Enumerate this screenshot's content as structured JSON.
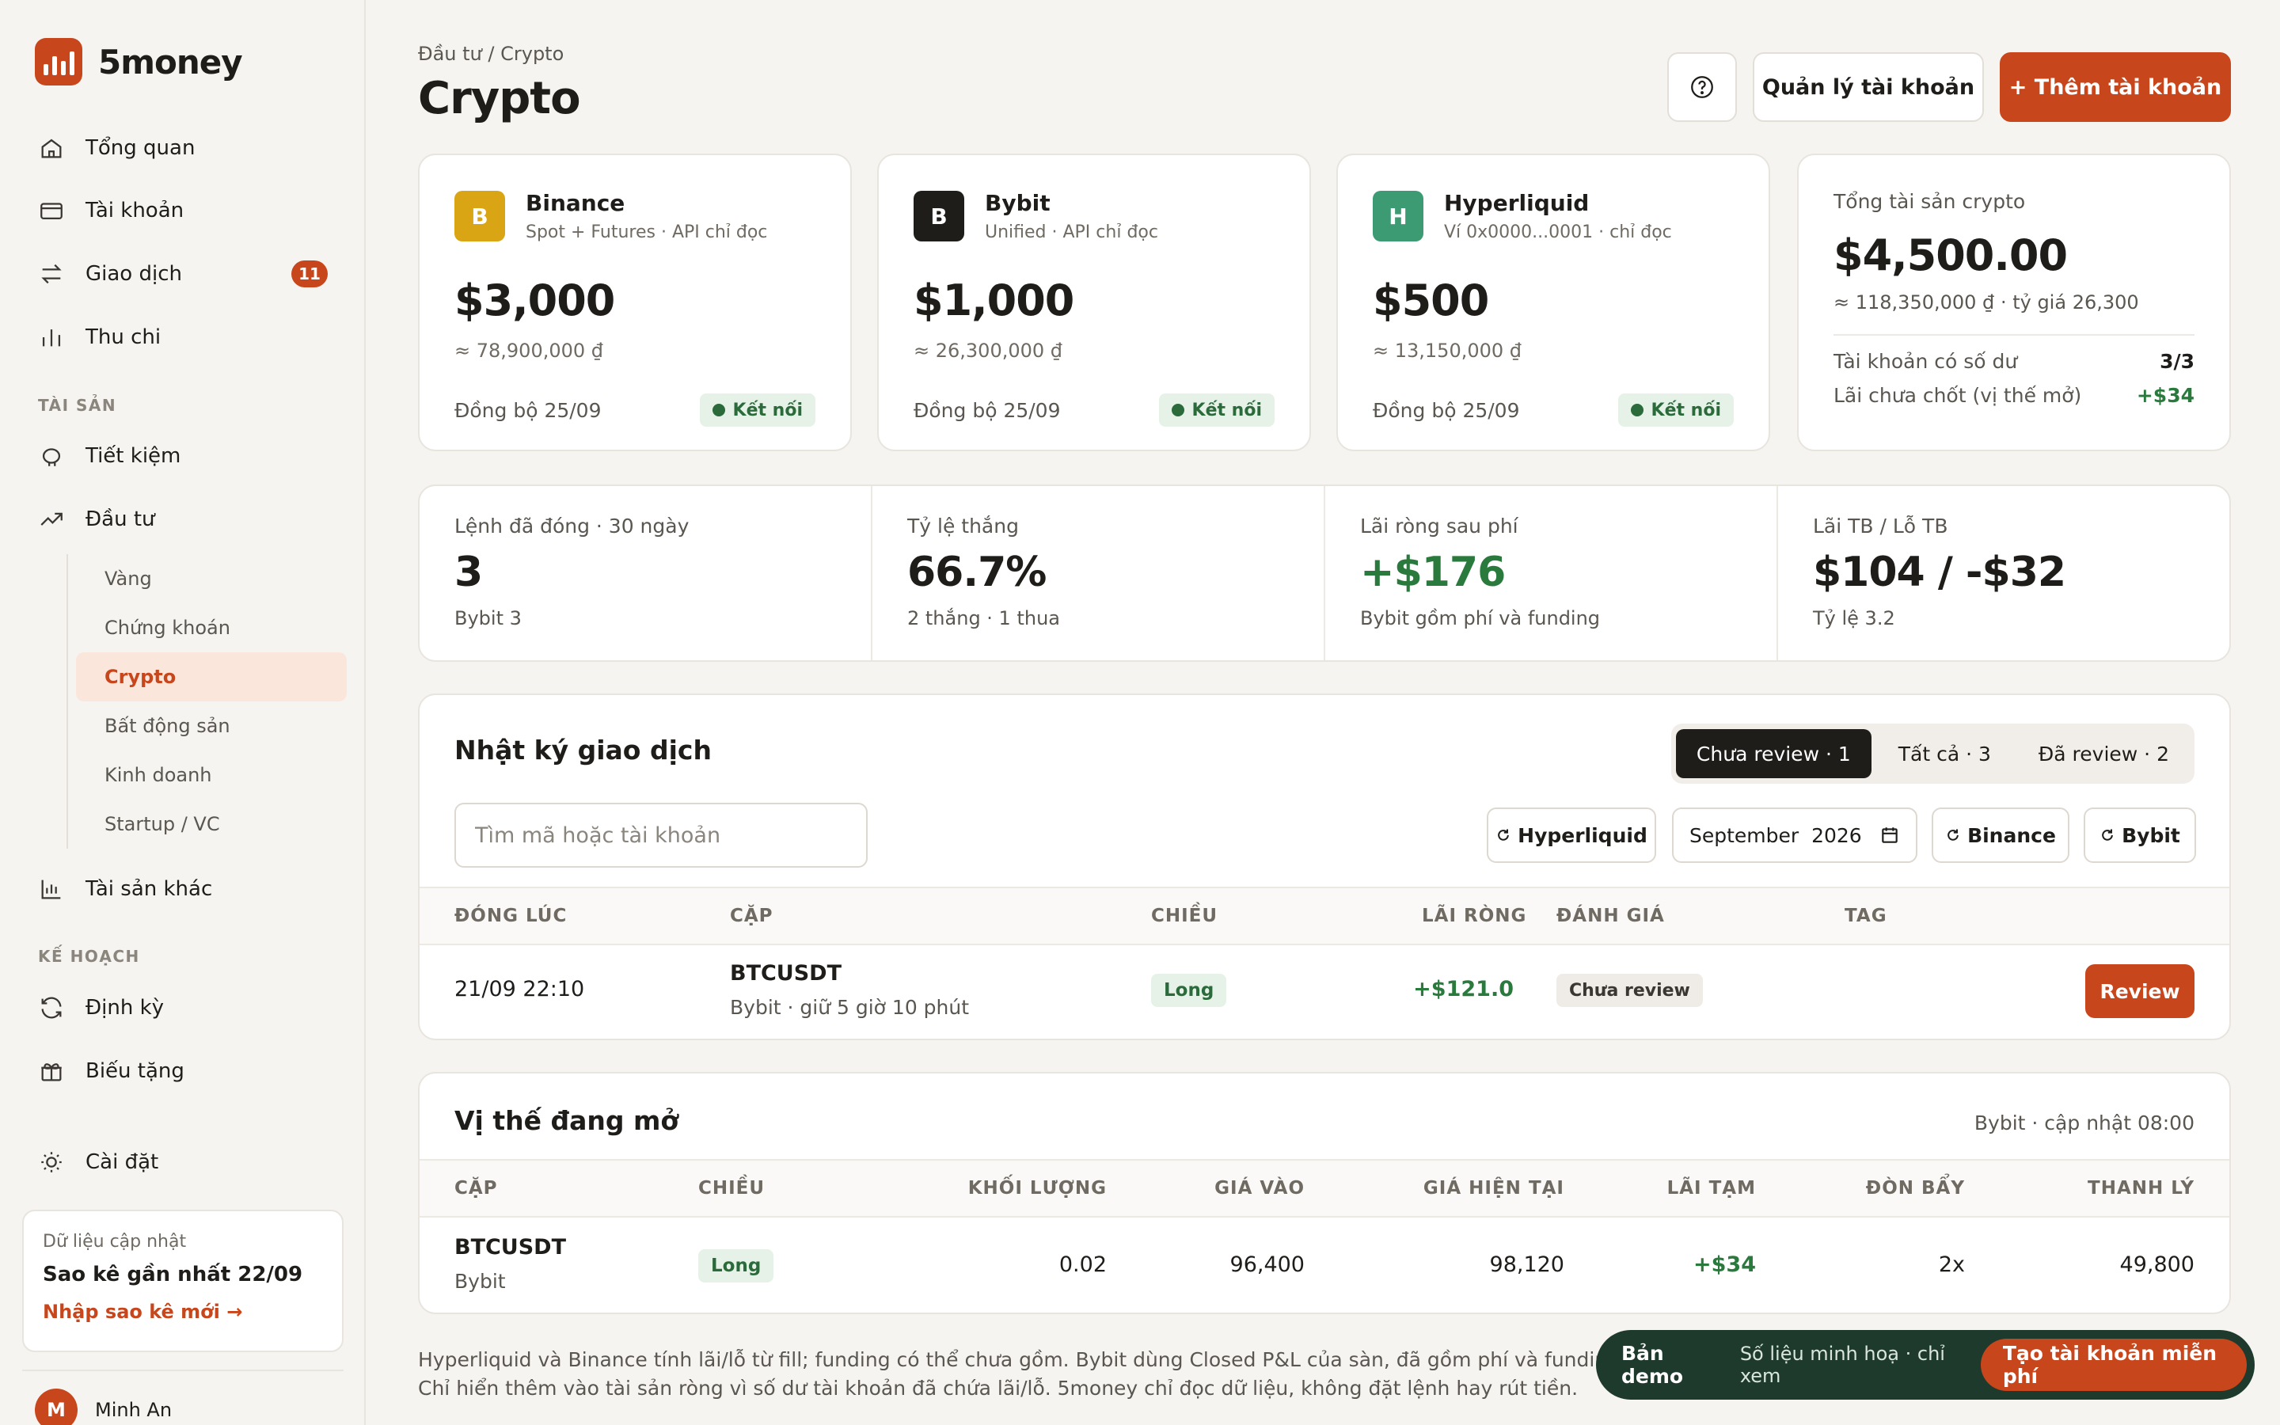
{
  "brand": {
    "name": "5money"
  },
  "sidebar": {
    "nav": [
      {
        "label": "Tổng quan",
        "icon": "home-icon"
      },
      {
        "label": "Tài khoản",
        "icon": "wallet-icon"
      },
      {
        "label": "Giao dịch",
        "icon": "transfer-icon",
        "badge": "11"
      },
      {
        "label": "Thu chi",
        "icon": "bar-chart-icon"
      }
    ],
    "section_assets": "TÀI SẢN",
    "assets": [
      {
        "label": "Tiết kiệm",
        "icon": "piggy-bank-icon"
      },
      {
        "label": "Đầu tư",
        "icon": "trending-up-icon"
      }
    ],
    "invest_sub": [
      "Vàng",
      "Chứng khoán",
      "Crypto",
      "Bất động sản",
      "Kinh doanh",
      "Startup / VC"
    ],
    "other_assets": {
      "label": "Tài sản khác",
      "icon": "chart-icon"
    },
    "section_plan": "KẾ HOẠCH",
    "plan": [
      {
        "label": "Định kỳ",
        "icon": "repeat-icon"
      },
      {
        "label": "Biếu tặng",
        "icon": "gift-icon"
      }
    ],
    "settings": {
      "label": "Cài đặt",
      "icon": "sun-gear-icon"
    },
    "data_card": {
      "label": "Dữ liệu cập nhật",
      "title": "Sao kê gần nhất 22/09",
      "link": "Nhập sao kê mới →"
    },
    "user": {
      "initial": "M",
      "name": "Minh An"
    }
  },
  "header": {
    "breadcrumb": "Đầu tư / Crypto",
    "title": "Crypto",
    "help_icon": "help-circle-icon",
    "manage_label": "Quản lý tài khoản",
    "add_label": "+ Thêm tài khoản"
  },
  "exchanges": [
    {
      "initial": "B",
      "name": "Binance",
      "sub": "Spot + Futures · API chỉ đọc",
      "amount": "$3,000",
      "vnd": "≈ 78,900,000 ₫",
      "sync": "Đồng bộ 25/09",
      "status": "Kết nối",
      "color": "#d9a514"
    },
    {
      "initial": "B",
      "name": "Bybit",
      "sub": "Unified · API chỉ đọc",
      "amount": "$1,000",
      "vnd": "≈ 26,300,000 ₫",
      "sync": "Đồng bộ 25/09",
      "status": "Kết nối",
      "color": "#1f1d1a"
    },
    {
      "initial": "H",
      "name": "Hyperliquid",
      "sub": "Ví 0x0000...0001 · chỉ đọc",
      "amount": "$500",
      "vnd": "≈ 13,150,000 ₫",
      "sync": "Đồng bộ 25/09",
      "status": "Kết nối",
      "color": "#3d9b74"
    }
  ],
  "total": {
    "label": "Tổng tài sản crypto",
    "amount": "$4,500.00",
    "rate": "≈ 118,350,000 ₫ · tỷ giá 26,300",
    "accounts_label": "Tài khoản có số dư",
    "accounts_value": "3/3",
    "unrealized_label": "Lãi chưa chốt (vị thế mở)",
    "unrealized_value": "+$34"
  },
  "stats": [
    {
      "label": "Lệnh đã đóng · 30 ngày",
      "value": "3",
      "sub": "Bybit 3"
    },
    {
      "label": "Tỷ lệ thắng",
      "value": "66.7%",
      "sub": "2 thắng · 1 thua"
    },
    {
      "label": "Lãi ròng sau phí",
      "value": "+$176",
      "sub": "Bybit gồm phí và funding"
    },
    {
      "label": "Lãi TB / Lỗ TB",
      "value": "$104 / -$32",
      "sub": "Tỷ lệ 3.2"
    }
  ],
  "journal": {
    "title": "Nhật ký giao dịch",
    "tabs": [
      "Chưa review · 1",
      "Tất cả · 3",
      "Đã review · 2"
    ],
    "search_placeholder": "Tìm mã hoặc tài khoản",
    "filters": {
      "hyperliquid": "Hyperliquid",
      "month": "September",
      "year": "2026",
      "binance": "Binance",
      "bybit": "Bybit"
    },
    "columns": [
      "ĐÓNG LÚC",
      "CẶP",
      "CHIỀU",
      "LÃI RÒNG",
      "ĐÁNH GIÁ",
      "TAG"
    ],
    "rows": [
      {
        "closed": "21/09 22:10",
        "pair": "BTCUSDT",
        "pair_sub": "Bybit · giữ 5 giờ 10 phút",
        "side": "Long",
        "pnl": "+$121.0",
        "review": "Chưa review",
        "tag": "",
        "action": "Review"
      }
    ]
  },
  "positions": {
    "title": "Vị thế đang mở",
    "updated": "Bybit · cập nhật 08:00",
    "columns": [
      "CẶP",
      "CHIỀU",
      "KHỐI LƯỢNG",
      "GIÁ VÀO",
      "GIÁ HIỆN TẠI",
      "LÃI TẠM",
      "ĐÒN BẨY",
      "THANH LÝ"
    ],
    "rows": [
      {
        "pair": "BTCUSDT",
        "pair_sub": "Bybit",
        "side": "Long",
        "size": "0.02",
        "entry": "96,400",
        "mark": "98,120",
        "upnl": "+$34",
        "leverage": "2x",
        "liq": "49,800"
      }
    ]
  },
  "footnote": "Hyperliquid và Binance tính lãi/lỗ từ fill; funding có thể chưa gồm. Bybit dùng Closed P&L của sàn, đã gồm phí và funding. Chỉ hiển thêm vào tài sản ròng vì số dư tài khoản đã chứa lãi/lỗ. 5money chỉ đọc dữ liệu, không đặt lệnh hay rút tiền.",
  "demo": {
    "title": "Bản demo",
    "sub": "Số liệu minh hoạ · chỉ xem",
    "cta": "Tạo tài khoản miễn phí"
  },
  "colors": {
    "accent": "#c8461c",
    "positive": "#2b7a3d",
    "dark_green": "#1d3a2c"
  }
}
